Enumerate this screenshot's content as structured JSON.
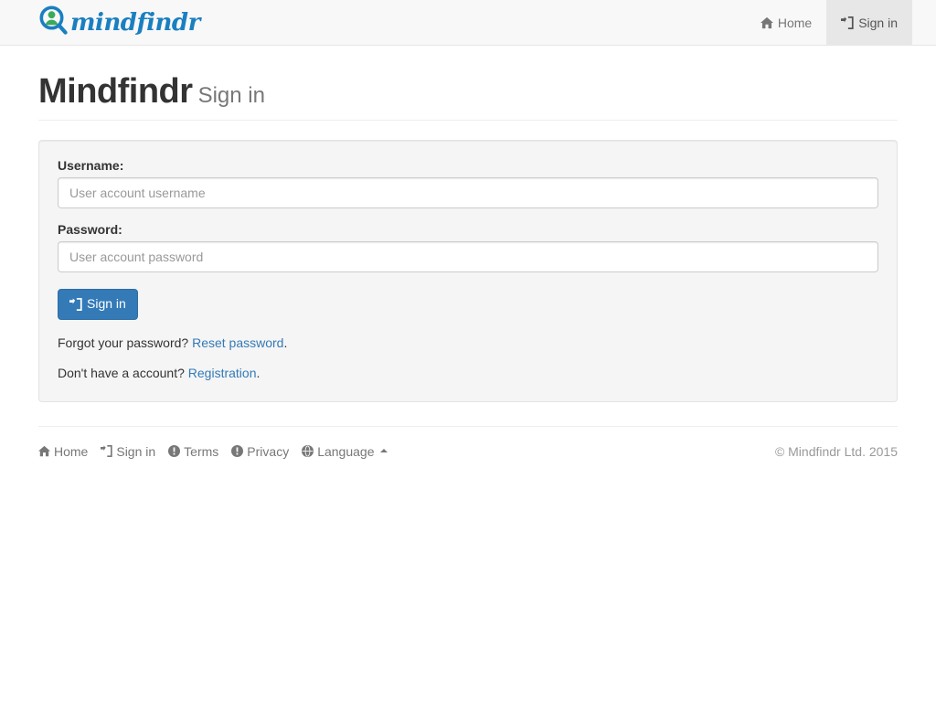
{
  "brand": {
    "name": "mindfindr",
    "logo_icon": "magnifier-person-icon",
    "ring_color": "#1a7fc1",
    "person_color": "#3aaa5c"
  },
  "navbar": {
    "items": [
      {
        "label": "Home",
        "icon": "home-icon",
        "active": false
      },
      {
        "label": "Sign in",
        "icon": "sign-in-icon",
        "active": true
      }
    ]
  },
  "page_header": {
    "title": "Mindfindr",
    "subtitle": "Sign in"
  },
  "form": {
    "username": {
      "label": "Username:",
      "placeholder": "User account username",
      "value": ""
    },
    "password": {
      "label": "Password:",
      "placeholder": "User account password",
      "value": ""
    },
    "submit": {
      "label": "Sign in",
      "icon": "sign-in-icon",
      "color": "#337ab7"
    },
    "forgot": {
      "text": "Forgot your password?",
      "link": "Reset password",
      "period": "."
    },
    "register": {
      "text": "Don't have a account?",
      "link": "Registration",
      "period": "."
    }
  },
  "footer": {
    "links": [
      {
        "label": "Home",
        "icon": "home-icon"
      },
      {
        "label": "Sign in",
        "icon": "sign-in-icon"
      },
      {
        "label": "Terms",
        "icon": "info-sign-icon"
      },
      {
        "label": "Privacy",
        "icon": "info-sign-icon"
      },
      {
        "label": "Language",
        "icon": "globe-icon",
        "caret": "caret-up-icon"
      }
    ],
    "copyright": "© Mindfindr Ltd. 2015"
  }
}
